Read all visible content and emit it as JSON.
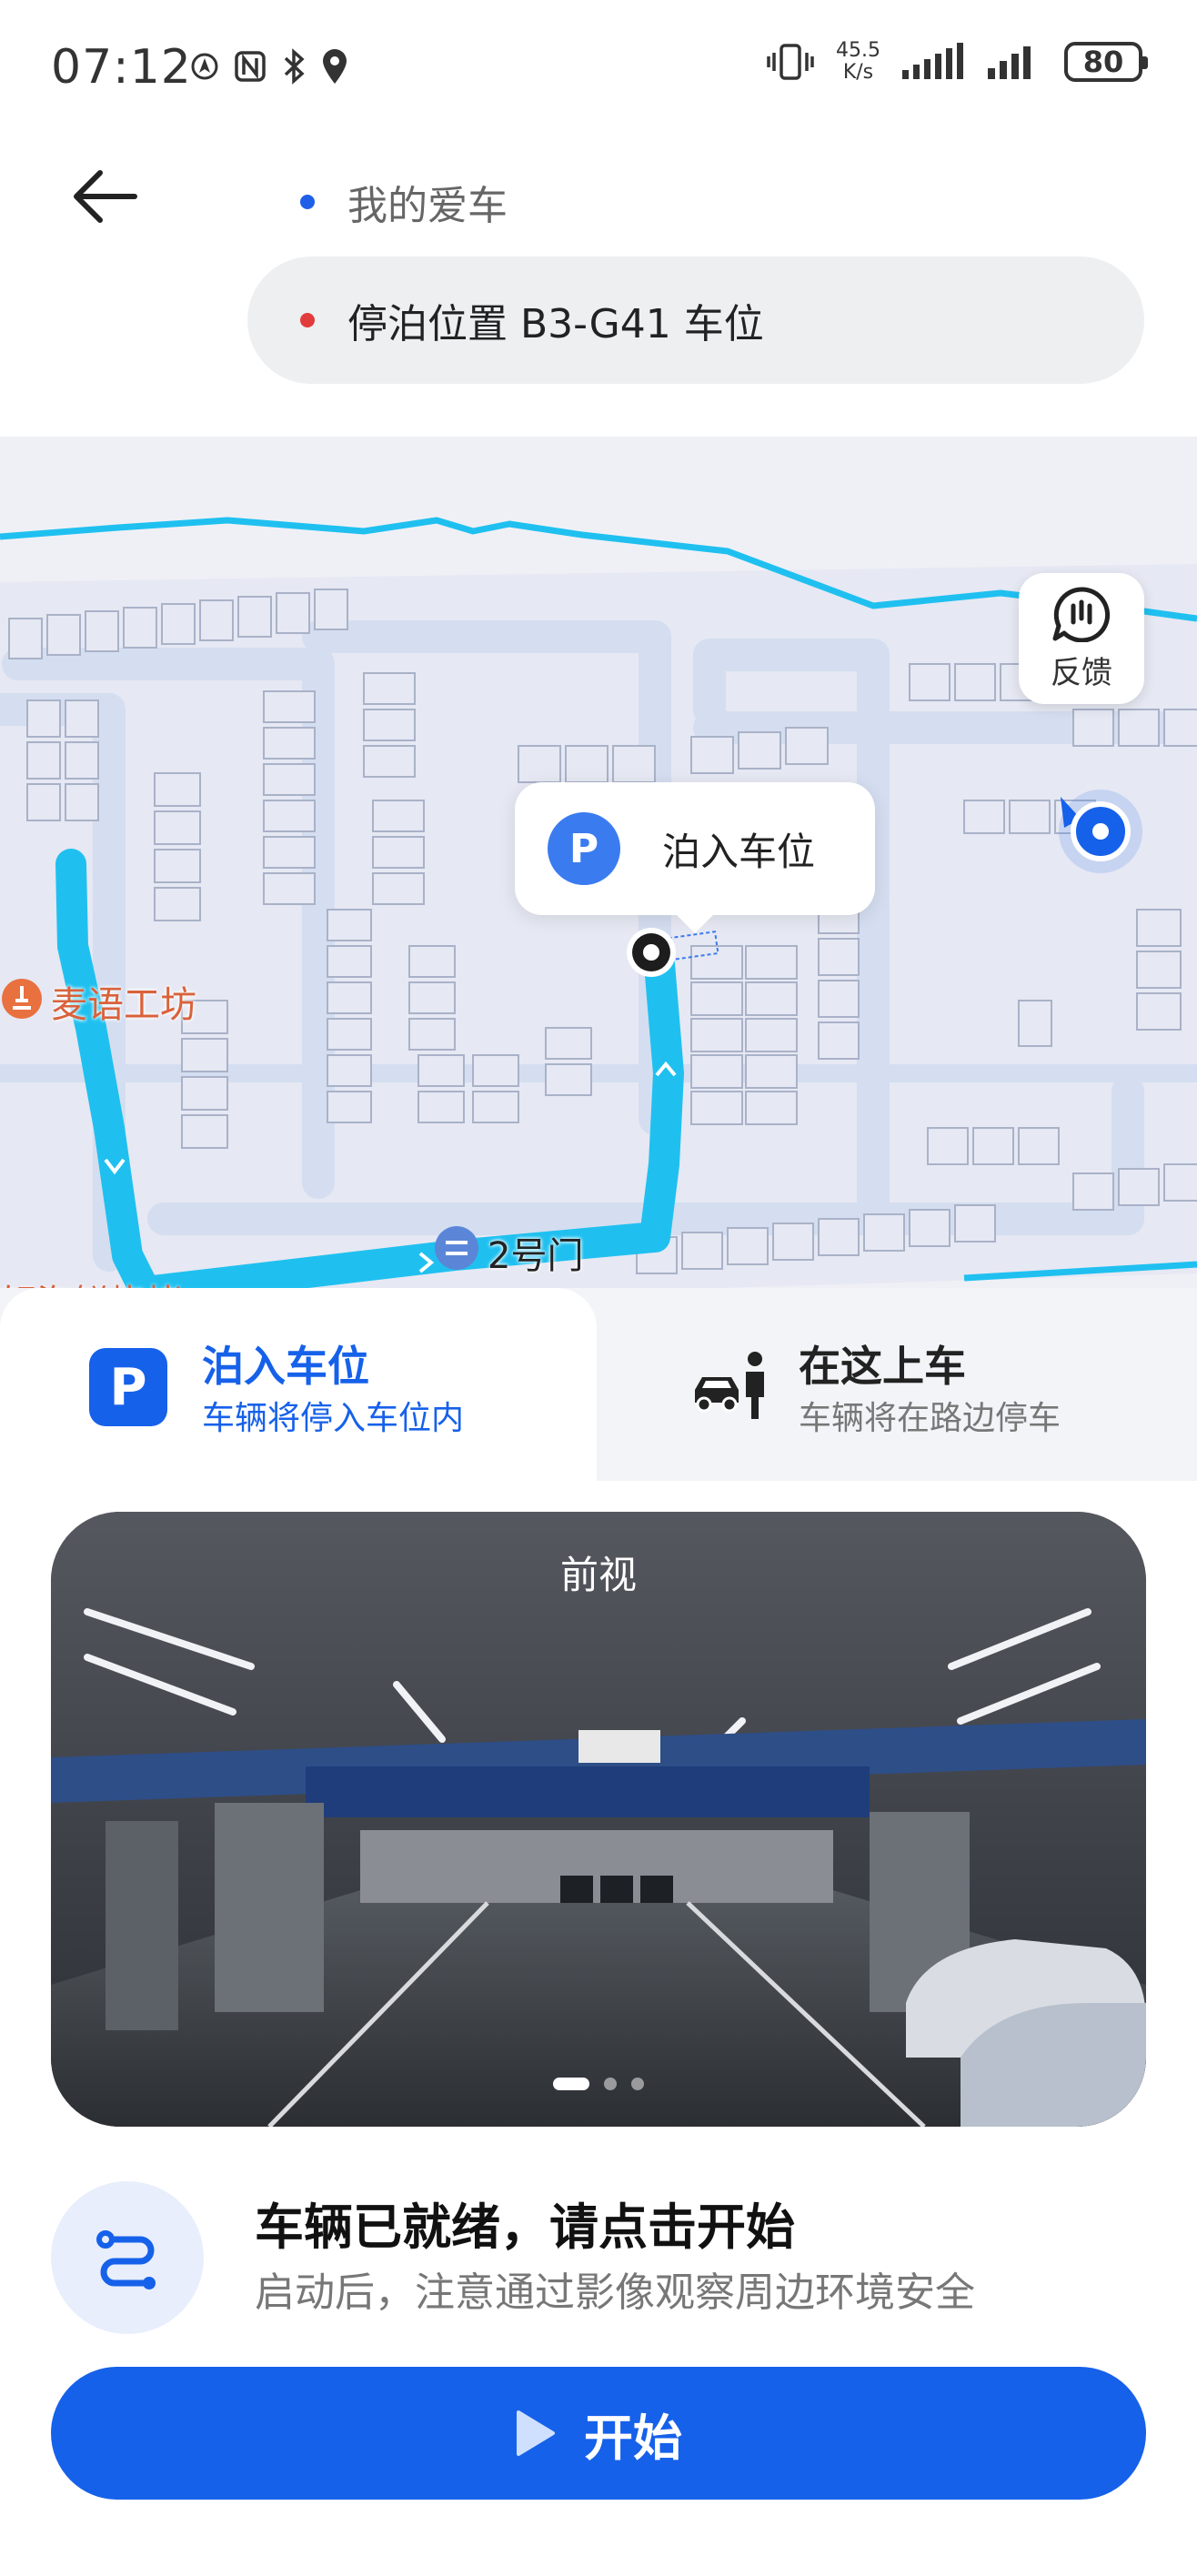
{
  "status_bar": {
    "time": "07:12",
    "network_speed_value": "45.5",
    "network_speed_unit": "K/s",
    "battery": "80"
  },
  "header": {
    "from_label": "我的爱车",
    "to_label": "停泊位置 B3-G41 车位",
    "from_dot_color": "#1f5fe8",
    "to_dot_color": "#e23b3b"
  },
  "map": {
    "feedback_label": "反馈",
    "bubble_icon": "P",
    "bubble_label": "泊入车位",
    "poi_label": "麦语工坊",
    "gate_label": "2号门",
    "street_label": "轩海鲜烧烤",
    "route_color": "#1fc0f0"
  },
  "mode_tabs": {
    "park": {
      "icon": "P",
      "title": "泊入车位",
      "subtitle": "车辆将停入车位内"
    },
    "pickup": {
      "title": "在这上车",
      "subtitle": "车辆将在路边停车"
    }
  },
  "camera": {
    "view_label": "前视",
    "pages": 3,
    "active_page": 1
  },
  "ready": {
    "title": "车辆已就绪，请点击开始",
    "subtitle": "启动后，注意通过影像观察周边环境安全"
  },
  "start_button": {
    "label": "开始"
  },
  "colors": {
    "accent": "#1661ea"
  }
}
